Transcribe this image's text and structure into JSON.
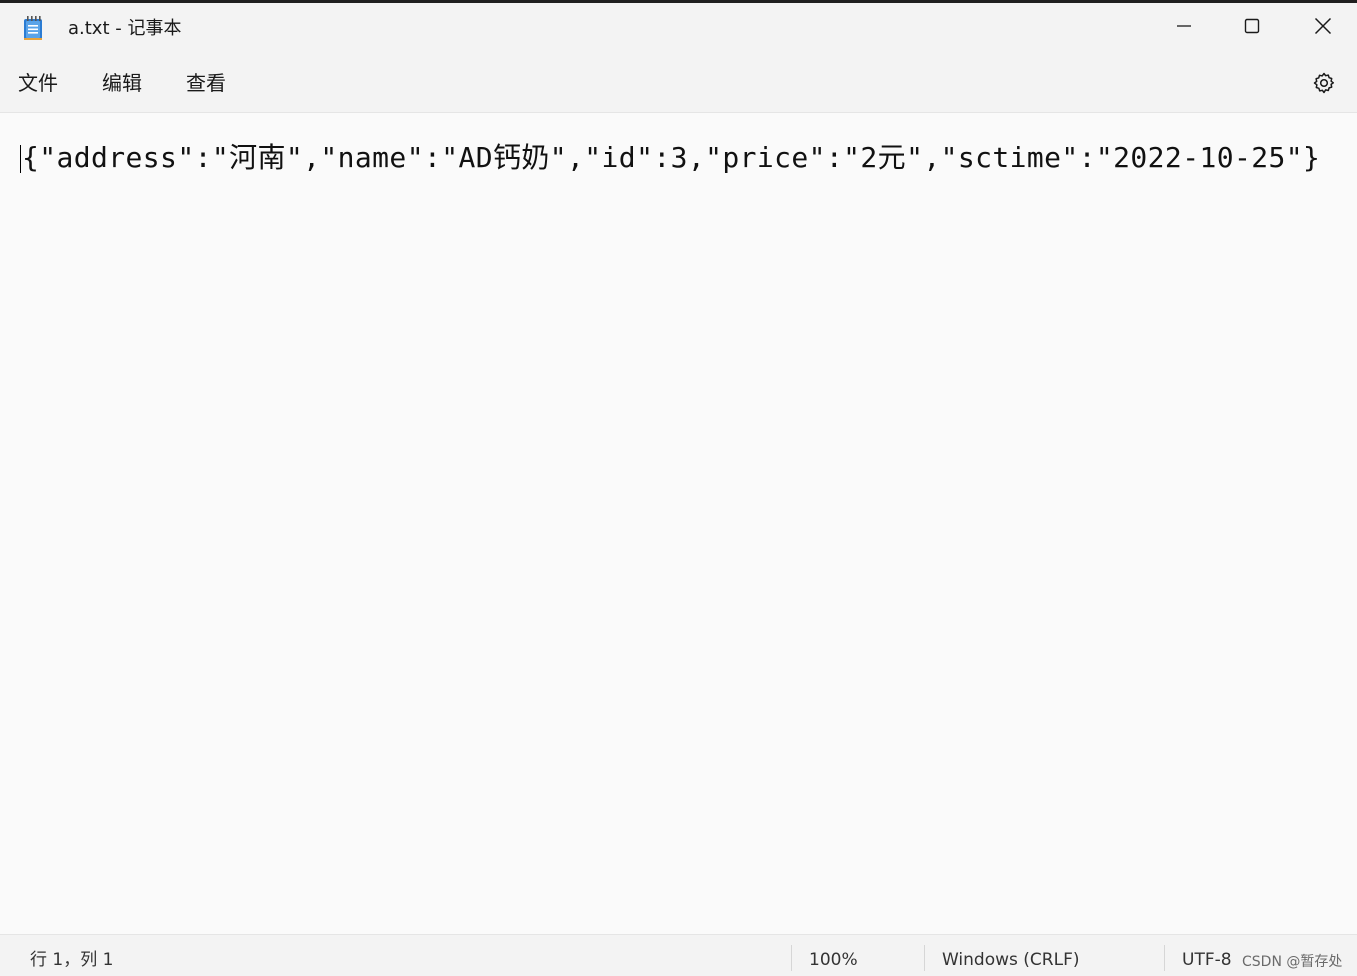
{
  "titlebar": {
    "app_icon": "notepad-icon",
    "title": "a.txt - 记事本",
    "minimize_icon": "minimize-icon",
    "maximize_icon": "maximize-icon",
    "close_icon": "close-icon"
  },
  "menubar": {
    "items": [
      {
        "label": "文件"
      },
      {
        "label": "编辑"
      },
      {
        "label": "查看"
      }
    ],
    "settings_icon": "gear-icon"
  },
  "editor": {
    "content": "{\"address\":\"河南\",\"name\":\"AD钙奶\",\"id\":3,\"price\":\"2元\",\"sctime\":\"2022-10-25\"}"
  },
  "statusbar": {
    "position": "行 1，列 1",
    "zoom": "100%",
    "line_ending": "Windows (CRLF)",
    "encoding": "UTF-8",
    "watermark": "CSDN @暂存处"
  },
  "colors": {
    "chrome_background": "#f3f3f3",
    "editor_background": "#fafafa",
    "icon_blue": "#2b7cd3",
    "text": "#111111"
  }
}
